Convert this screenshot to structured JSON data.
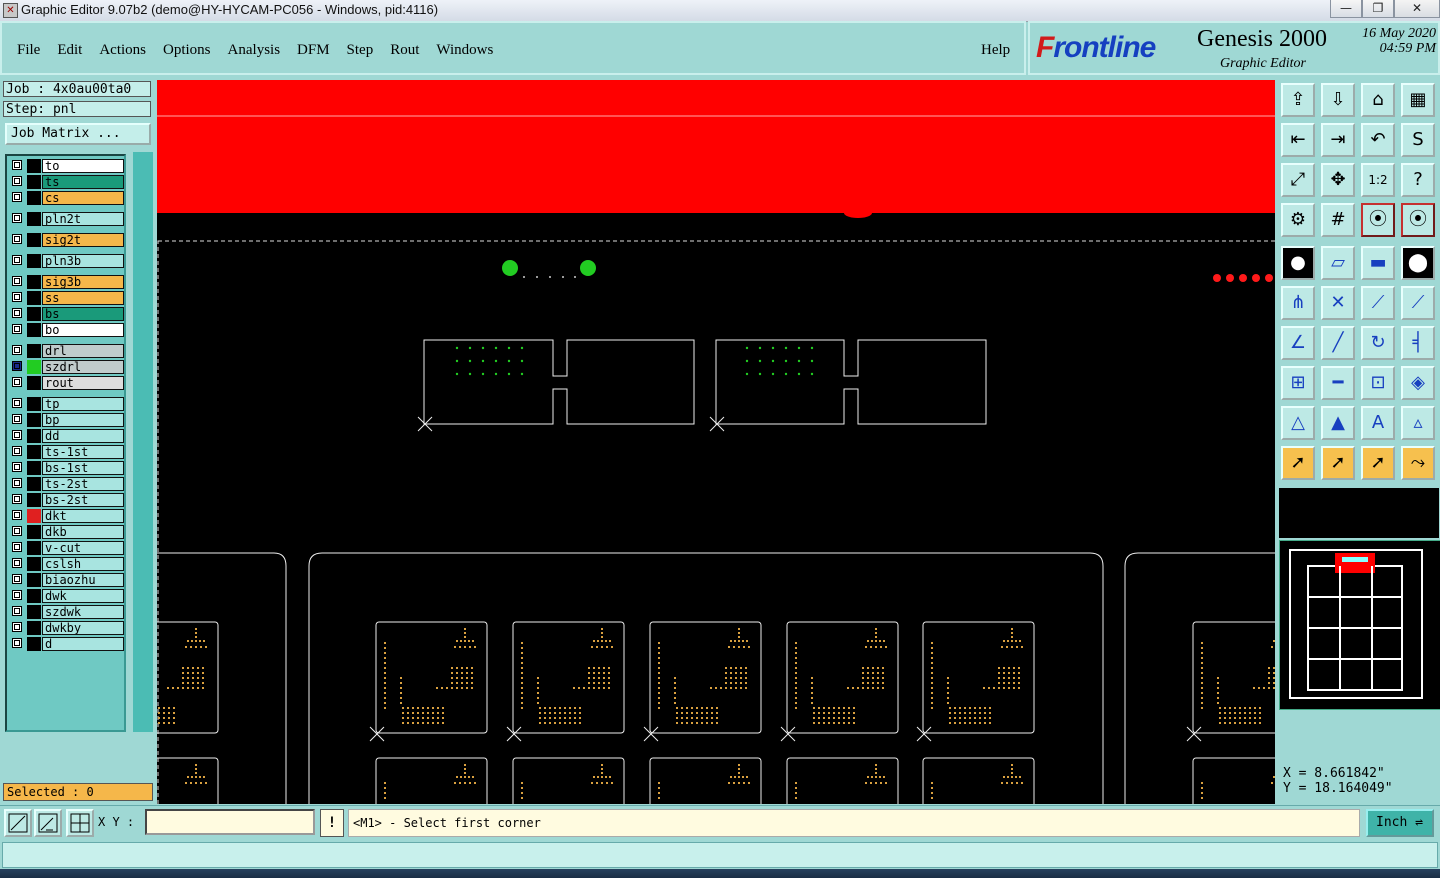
{
  "window": {
    "title": "Graphic Editor 9.07b2 (demo@HY-HYCAM-PC056 - Windows, pid:4116)",
    "min": "—",
    "max": "❐",
    "close": "✕"
  },
  "menu": {
    "items": [
      "File",
      "Edit",
      "Actions",
      "Options",
      "Analysis",
      "DFM",
      "Step",
      "Rout",
      "Windows"
    ],
    "help": "Help"
  },
  "brand": {
    "logo_f": "F",
    "logo_rest": "rontline",
    "product": "Genesis 2000",
    "subtitle": "Graphic Editor",
    "date": "16 May 2020",
    "time": "04:59 PM"
  },
  "job": {
    "job_label": "Job : 4x0au00ta0",
    "step_label": "Step: pnl",
    "matrix_button": "Job Matrix ..."
  },
  "layers": [
    {
      "name": "to",
      "color": "#ffffff",
      "swatch": "#000000"
    },
    {
      "name": "ts",
      "color": "#1a9a7a",
      "swatch": "#000000"
    },
    {
      "name": "cs",
      "color": "#f5b74a",
      "swatch": "#000000"
    },
    {
      "name": "pln2t",
      "color": "#a8e4e0",
      "swatch": "#000000"
    },
    {
      "name": "sig2t",
      "color": "#f5b74a",
      "swatch": "#000000"
    },
    {
      "name": "pln3b",
      "color": "#a8e4e0",
      "swatch": "#000000"
    },
    {
      "name": "sig3b",
      "color": "#f5b74a",
      "swatch": "#000000"
    },
    {
      "name": "ss",
      "color": "#f5b74a",
      "swatch": "#000000"
    },
    {
      "name": "bs",
      "color": "#1a9a7a",
      "swatch": "#000000"
    },
    {
      "name": "bo",
      "color": "#ffffff",
      "swatch": "#000000"
    },
    {
      "name": "drl",
      "color": "#c0cccc",
      "swatch": "#000000"
    },
    {
      "name": "szdrl",
      "color": "#c0cccc",
      "swatch": "#22cc22"
    },
    {
      "name": "rout",
      "color": "#dddddd",
      "swatch": "#000000"
    },
    {
      "name": "tp",
      "color": "#a8e4e0",
      "swatch": "#000000"
    },
    {
      "name": "bp",
      "color": "#a8e4e0",
      "swatch": "#000000"
    },
    {
      "name": "dd",
      "color": "#a8e4e0",
      "swatch": "#000000"
    },
    {
      "name": "ts-1st",
      "color": "#a8e4e0",
      "swatch": "#000000"
    },
    {
      "name": "bs-1st",
      "color": "#a8e4e0",
      "swatch": "#000000"
    },
    {
      "name": "ts-2st",
      "color": "#a8e4e0",
      "swatch": "#000000"
    },
    {
      "name": "bs-2st",
      "color": "#a8e4e0",
      "swatch": "#000000"
    },
    {
      "name": "dkt",
      "color": "#a8e4e0",
      "swatch": "#e02020"
    },
    {
      "name": "dkb",
      "color": "#a8e4e0",
      "swatch": "#000000"
    },
    {
      "name": "v-cut",
      "color": "#a8e4e0",
      "swatch": "#000000"
    },
    {
      "name": "cslsh",
      "color": "#a8e4e0",
      "swatch": "#000000"
    },
    {
      "name": "biaozhu",
      "color": "#a8e4e0",
      "swatch": "#000000"
    },
    {
      "name": "dwk",
      "color": "#a8e4e0",
      "swatch": "#000000"
    },
    {
      "name": "szdwk",
      "color": "#a8e4e0",
      "swatch": "#000000"
    },
    {
      "name": "dwkby",
      "color": "#a8e4e0",
      "swatch": "#000000"
    },
    {
      "name": "d",
      "color": "#a8e4e0",
      "swatch": "#000000"
    }
  ],
  "selected": "Selected : 0",
  "coords": {
    "x": "X = 8.661842\"",
    "y": "Y = 18.164049\""
  },
  "status": {
    "xy_label": "X Y :",
    "xy_value": "",
    "warn": "!",
    "prompt": "<M1> - Select first corner",
    "units": "Inch"
  }
}
